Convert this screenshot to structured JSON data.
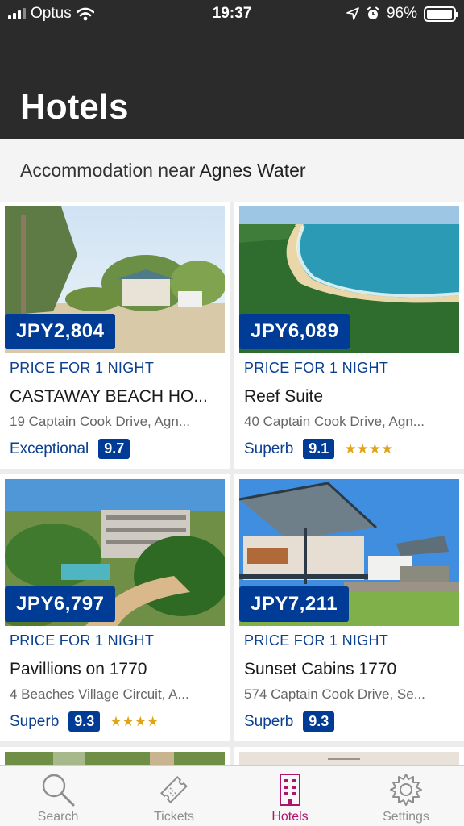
{
  "status_bar": {
    "carrier": "Optus",
    "time": "19:37",
    "battery": "96%",
    "battery_level": 0.96,
    "signal_icon": "signal-bars-icon",
    "wifi_icon": "wifi-icon",
    "location_icon": "location-arrow-icon",
    "alarm_icon": "alarm-icon"
  },
  "header": {
    "title": "Hotels"
  },
  "subtitle": {
    "prefix": "Accommodation near",
    "place": "Agnes Water"
  },
  "colors": {
    "header_bg": "#2b2b2b",
    "brand_blue": "#003b95",
    "active_tab": "#b0136a",
    "star": "#e0a41a"
  },
  "hotels": [
    {
      "price": "JPY2,804",
      "price_label": "PRICE FOR 1 NIGHT",
      "name": "CASTAWAY BEACH HO...",
      "address": "19 Captain Cook Drive, Agn...",
      "rating_word": "Exceptional",
      "score": "9.7",
      "stars": ""
    },
    {
      "price": "JPY6,089",
      "price_label": "PRICE FOR 1 NIGHT",
      "name": "Reef Suite",
      "address": "40 Captain Cook Drive, Agn...",
      "rating_word": "Superb",
      "score": "9.1",
      "stars": "★★★★"
    },
    {
      "price": "JPY6,797",
      "price_label": "PRICE FOR 1 NIGHT",
      "name": "Pavillions on 1770",
      "address": "4 Beaches Village Circuit, A...",
      "rating_word": "Superb",
      "score": "9.3",
      "stars": "★★★★"
    },
    {
      "price": "JPY7,211",
      "price_label": "PRICE FOR 1 NIGHT",
      "name": "Sunset Cabins 1770",
      "address": "574 Captain Cook Drive, Se...",
      "rating_word": "Superb",
      "score": "9.3",
      "stars": ""
    }
  ],
  "tabs": [
    {
      "label": "Search",
      "icon": "search-icon",
      "active": false
    },
    {
      "label": "Tickets",
      "icon": "ticket-icon",
      "active": false
    },
    {
      "label": "Hotels",
      "icon": "hotel-building-icon",
      "active": true
    },
    {
      "label": "Settings",
      "icon": "gear-icon",
      "active": false
    }
  ]
}
